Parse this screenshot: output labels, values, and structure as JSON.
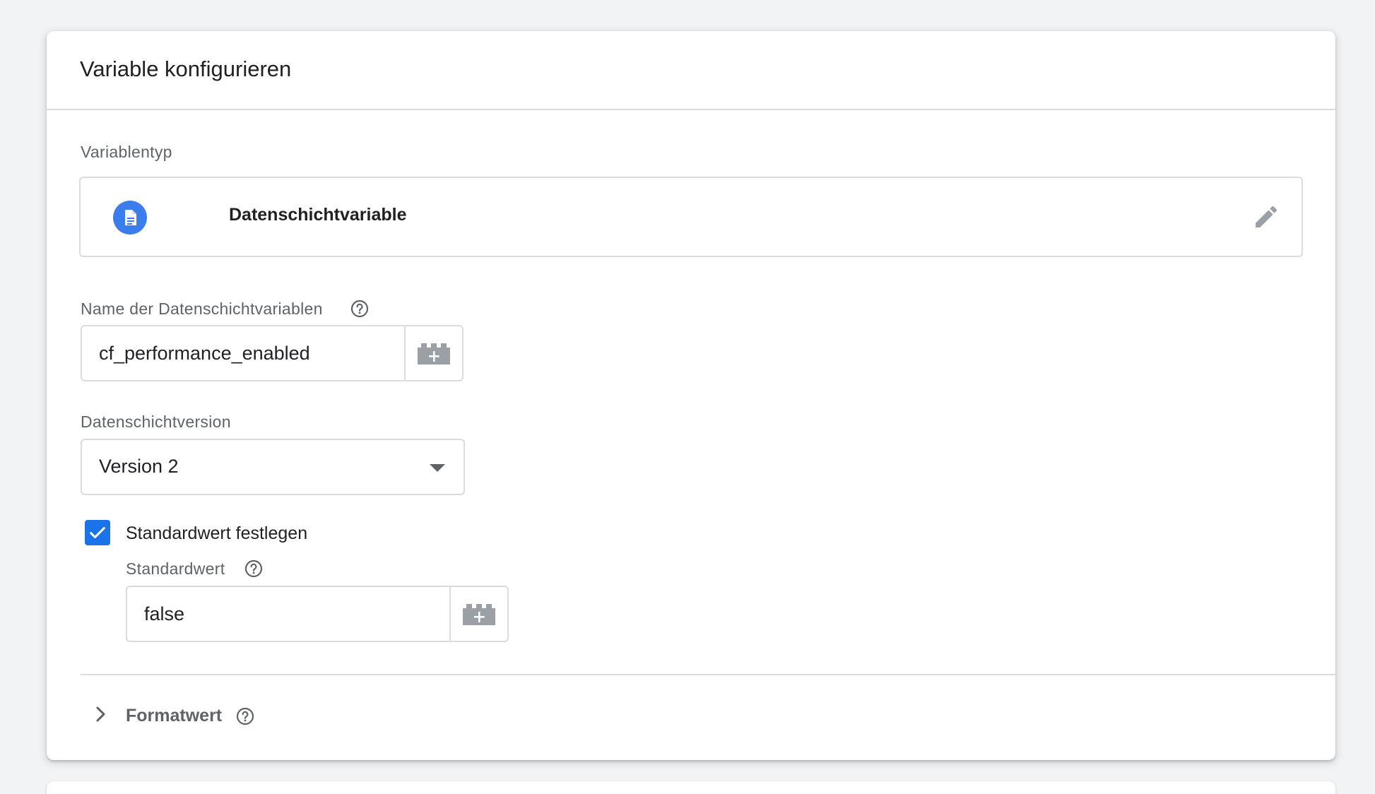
{
  "card": {
    "title": "Variable konfigurieren"
  },
  "variable_type": {
    "label": "Variablentyp",
    "name": "Datenschichtvariable",
    "icon": "document-icon",
    "icon_color": "#3b7ded",
    "edit_icon": "pencil-icon"
  },
  "datalayer_name": {
    "label": "Name der Datenschichtvariablen",
    "value": "cf_performance_enabled",
    "variable_button_icon": "variable-brick-icon"
  },
  "datalayer_version": {
    "label": "Datenschichtversion",
    "selected": "Version 2"
  },
  "default_value": {
    "checkbox_label": "Standardwert festlegen",
    "checked": true,
    "checkbox_color": "#1a73e8",
    "label": "Standardwert",
    "value": "false"
  },
  "format_value": {
    "label": "Formatwert"
  }
}
